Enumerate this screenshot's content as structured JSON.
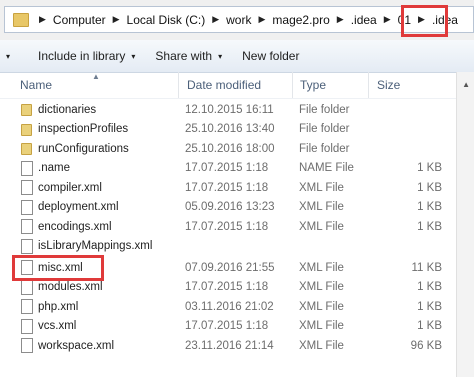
{
  "address": {
    "crumbs": [
      "Computer",
      "Local Disk (C:)",
      "work",
      "mage2.pro",
      ".idea",
      "01",
      ".idea"
    ],
    "separator": "▶"
  },
  "toolbar": {
    "organize": "",
    "include_in_library": "Include in library",
    "share_with": "Share with",
    "new_folder": "New folder"
  },
  "columns": {
    "name": "Name",
    "date_modified": "Date modified",
    "type": "Type",
    "size": "Size"
  },
  "files": [
    {
      "name": "dictionaries",
      "date": "12.10.2015 16:11",
      "type": "File folder",
      "size": "",
      "icon": "folder-icon"
    },
    {
      "name": "inspectionProfiles",
      "date": "25.10.2016 13:40",
      "type": "File folder",
      "size": "",
      "icon": "folder-icon"
    },
    {
      "name": "runConfigurations",
      "date": "25.10.2016 18:00",
      "type": "File folder",
      "size": "",
      "icon": "folder-icon"
    },
    {
      "name": ".name",
      "date": "17.07.2015 1:18",
      "type": "NAME File",
      "size": "1 KB",
      "icon": "file-icon"
    },
    {
      "name": "compiler.xml",
      "date": "17.07.2015 1:18",
      "type": "XML File",
      "size": "1 KB",
      "icon": "file-icon"
    },
    {
      "name": "deployment.xml",
      "date": "05.09.2016 13:23",
      "type": "XML File",
      "size": "1 KB",
      "icon": "file-icon"
    },
    {
      "name": "encodings.xml",
      "date": "17.07.2015 1:18",
      "type": "XML File",
      "size": "1 KB",
      "icon": "file-icon"
    },
    {
      "name": "isLibraryMappings.xml",
      "date": "",
      "type": "",
      "size": "",
      "icon": "file-icon"
    },
    {
      "name": "misc.xml",
      "date": "07.09.2016 21:55",
      "type": "XML File",
      "size": "11 KB",
      "icon": "file-icon"
    },
    {
      "name": "modules.xml",
      "date": "17.07.2015 1:18",
      "type": "XML File",
      "size": "1 KB",
      "icon": "file-icon"
    },
    {
      "name": "php.xml",
      "date": "03.11.2016 21:02",
      "type": "XML File",
      "size": "1 KB",
      "icon": "file-icon"
    },
    {
      "name": "vcs.xml",
      "date": "17.07.2015 1:18",
      "type": "XML File",
      "size": "1 KB",
      "icon": "file-icon"
    },
    {
      "name": "workspace.xml",
      "date": "23.11.2016 21:14",
      "type": "XML File",
      "size": "96 KB",
      "icon": "file-icon"
    }
  ],
  "colors": {
    "highlight": "#e03a3a",
    "toolbar_top": "#f6f9fc",
    "toolbar_bottom": "#e4ebf4",
    "header_text": "#4c607a"
  }
}
